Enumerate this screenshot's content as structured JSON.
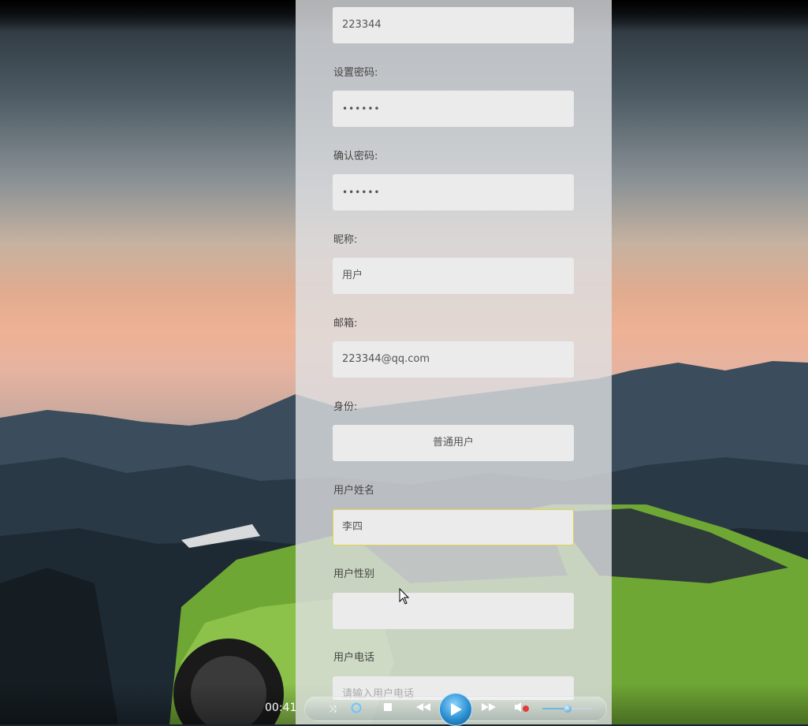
{
  "form": {
    "account_value": "223344",
    "password": {
      "label": "设置密码:",
      "value": "••••••"
    },
    "confirm_password": {
      "label": "确认密码:",
      "value": "••••••"
    },
    "nickname": {
      "label": "昵称:",
      "value": "用户"
    },
    "email": {
      "label": "邮箱:",
      "value": "223344@qq.com"
    },
    "identity": {
      "label": "身份:",
      "value": "普通用户"
    },
    "real_name": {
      "label": "用户姓名",
      "value": "李四"
    },
    "gender": {
      "label": "用户性别",
      "value": ""
    },
    "phone": {
      "label": "用户电话",
      "placeholder": "请输入用户电话"
    }
  },
  "player": {
    "time": "00:41",
    "volume_level": 0.5,
    "icons": [
      "shuffle-icon",
      "repeat-icon",
      "stop-icon",
      "rewind-icon",
      "play-icon",
      "fast-forward-icon",
      "mute-icon"
    ]
  },
  "colors": {
    "panel": "#dee0e2",
    "input_bg": "#ebebeb",
    "focus_border": "#e5d24a",
    "play_button": "#2b8fd0"
  }
}
